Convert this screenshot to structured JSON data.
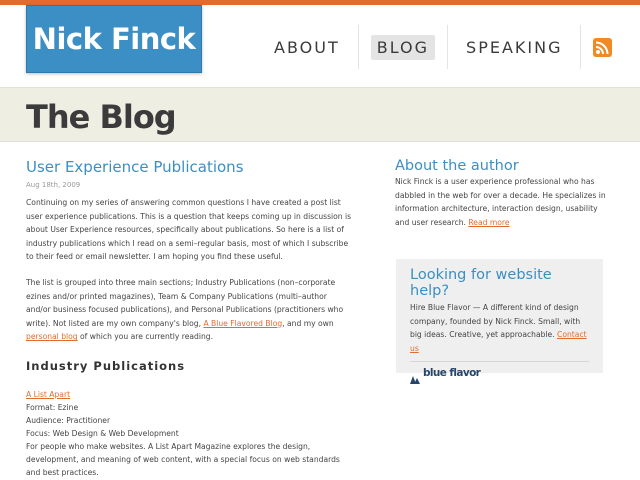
{
  "header": {
    "logo_text": "Nick Finck",
    "nav": [
      {
        "label": "ABOUT"
      },
      {
        "label": "BLOG"
      },
      {
        "label": "SPEAKING"
      }
    ],
    "rss_icon": "rss-icon"
  },
  "band": {
    "title": "The Blog"
  },
  "post": {
    "title": "User Experience Publications",
    "date": "Aug 18th, 2009",
    "p1": "Continuing on my series of answering common questions I have created a post list user experience publications.  This is a question that keeps coming up in discussion is about User Experience resources, specifically about publications.  So here is a list of industry publications which I read on a semi–regular basis, most of which I subscribe to their feed or email newsletter.  I am hoping you find these useful.",
    "p2_a": "The list is grouped into three main sections; Industry Publications (non–corporate ezines and/or printed magazines), Team & Company Publications (multi–author and/or business focused publications), and Personal Publications (practitioners who write).  Not listed are my own company's blog, ",
    "p2_link1": "A Blue Flavored Blog",
    "p2_b": ", and my own ",
    "p2_link2": "personal blog",
    "p2_c": " of which you are currently reading.",
    "section_heading": "Industry Publications",
    "item": {
      "name": "A List Apart",
      "format": "Format: Ezine",
      "audience": "Audience: Practitioner",
      "focus": "Focus: Web Design & Web Development",
      "description": "For people who make websites. A List Apart Magazine explores the design, development, and meaning of web content, with a special focus on web standards and best practices."
    }
  },
  "sidebar": {
    "about_title": "About the author",
    "about_text": "Nick Finck is a user experience professional who has dabbled in the web for over a decade. He specializes in information architecture, interaction design, usability and user research. ",
    "about_link": "Read more",
    "promo_title": "Looking for website help?",
    "promo_text": "Hire Blue Flavor — A different kind of design company, founded by Nick Finck. Small, with big ideas. Creative, yet approachable. ",
    "promo_link": "Contact us",
    "promo_logo": "blue flavor"
  },
  "colors": {
    "accent_orange": "#e36b2c",
    "link_blue": "#3b8fc2",
    "logo_blue": "#3c8fc4",
    "band_bg": "#efeee2"
  }
}
